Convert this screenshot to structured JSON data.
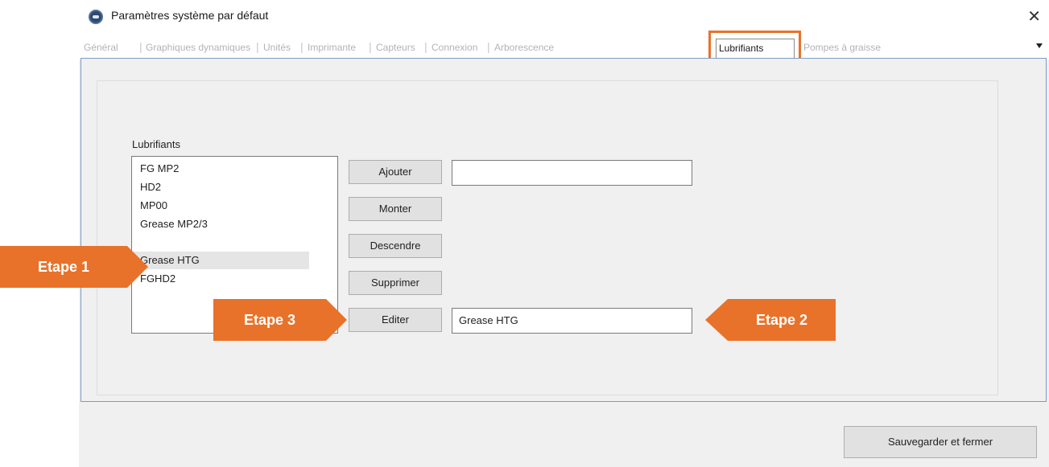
{
  "window": {
    "title": "Paramètres système par défaut",
    "close_glyph": "✕"
  },
  "tabs": [
    {
      "label": "Général",
      "active": false
    },
    {
      "label": "Graphiques dynamiques",
      "active": false
    },
    {
      "label": "Unités",
      "active": false
    },
    {
      "label": "Imprimante",
      "active": false
    },
    {
      "label": "Capteurs",
      "active": false
    },
    {
      "label": "Connexion",
      "active": false
    },
    {
      "label": "Arborescence",
      "active": false
    },
    {
      "label": "Lubrifiants",
      "active": true
    },
    {
      "label": "Pompes à graisse",
      "active": false
    }
  ],
  "lubricants": {
    "label": "Lubrifiants",
    "items": [
      "FG MP2",
      "HD2",
      "MP00",
      "Grease MP2/3",
      "Grease HTG",
      "FGHD2"
    ],
    "selected": "Grease HTG"
  },
  "buttons": {
    "add": "Ajouter",
    "up": "Monter",
    "down": "Descendre",
    "delete": "Supprimer",
    "edit": "Editer",
    "save_close": "Sauvegarder et fermer"
  },
  "fields": {
    "new_name_value": "",
    "edit_value": "Grease HTG"
  },
  "annotations": {
    "step1": "Etape 1",
    "step2": "Etape 2",
    "step3": "Etape 3"
  },
  "colors": {
    "callout": "#e8722a",
    "panel_border": "#7a9cc5",
    "dialog_bg": "#f0f0f0"
  },
  "icons": {
    "app": "app-logo-icon",
    "close": "close-icon",
    "tab_scroll": "chevron-down-icon"
  }
}
